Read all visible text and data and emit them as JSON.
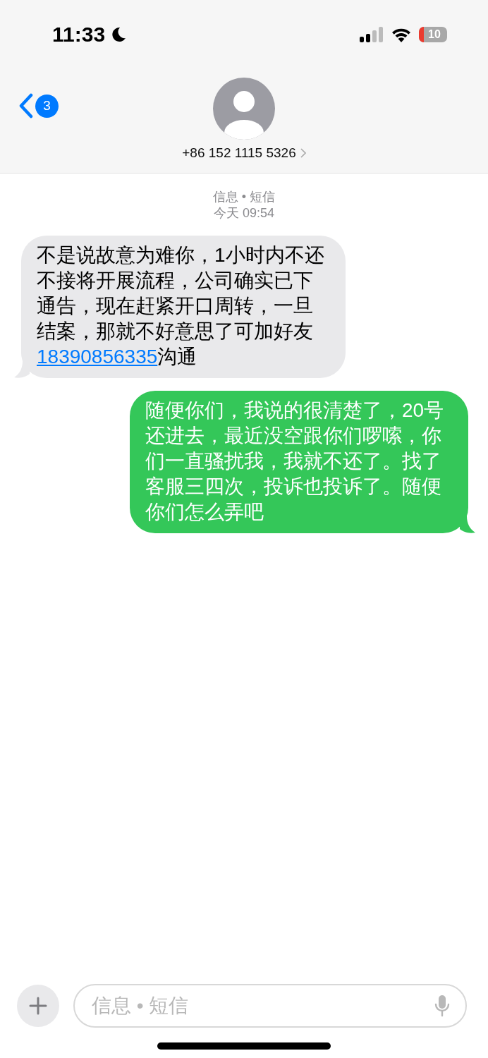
{
  "status_bar": {
    "time": "11:33",
    "do_not_disturb": true,
    "battery": "10",
    "low_battery": true
  },
  "header": {
    "back_badge": "3",
    "contact": "+86 152 1115 5326"
  },
  "thread": {
    "service": "信息 • 短信",
    "timestamp": "今天 09:54"
  },
  "messages": [
    {
      "kind": "incoming",
      "parts": [
        {
          "kind": "text",
          "text": "不是说故意为难你，1小时内不还不接将开展流程，公司确实已下通告，现在赶紧开口周转，一旦结案，那就不好意思了可加好友"
        },
        {
          "kind": "link",
          "text": "18390856335"
        },
        {
          "kind": "text",
          "text": "沟通"
        }
      ]
    },
    {
      "kind": "outgoing",
      "parts": [
        {
          "kind": "text",
          "text": "随便你们，我说的很清楚了，20号还进去，最近没空跟你们啰嗦，你们一直骚扰我，我就不还了。找了客服三四次，投诉也投诉了。随便你们怎么弄吧"
        }
      ]
    }
  ],
  "composer": {
    "placeholder": "信息 • 短信"
  }
}
